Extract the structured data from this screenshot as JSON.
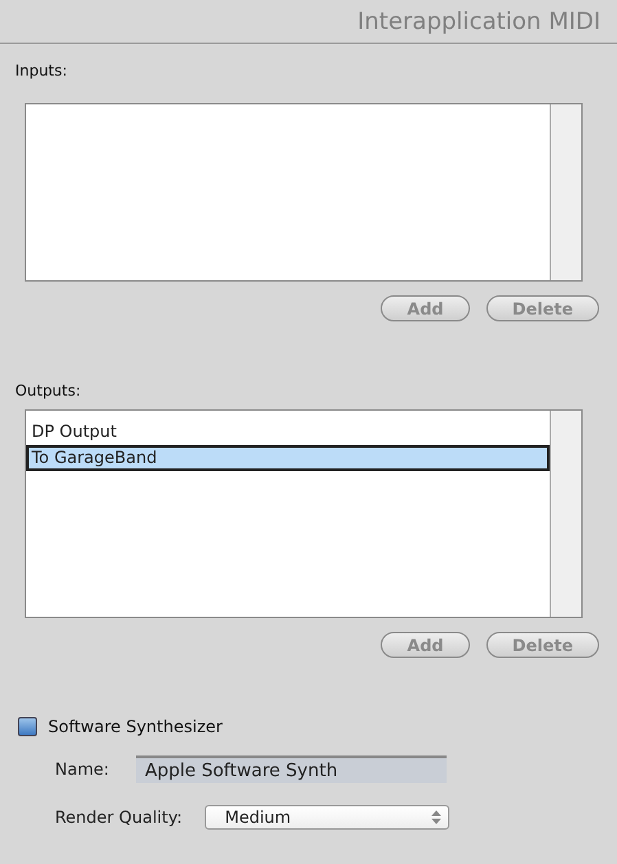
{
  "window": {
    "title": "Interapplication MIDI"
  },
  "inputs": {
    "label": "Inputs:",
    "buttons": [
      {
        "label": "Add",
        "disabled": true
      },
      {
        "label": "Delete",
        "disabled": true
      }
    ]
  },
  "outputs": {
    "label": "Outputs:",
    "items": [
      {
        "label": "DP Output",
        "selected": false
      },
      {
        "label": "To GarageBand",
        "selected": true
      }
    ],
    "buttons": [
      {
        "label": "Add",
        "disabled": true
      },
      {
        "label": "Delete",
        "disabled": true
      }
    ]
  },
  "synth": {
    "label": "Software Synthesizer",
    "checked": false,
    "name_label": "Name:",
    "name_value": "Apple Software Synth",
    "name_disabled": true,
    "quality_label": "Render Quality:",
    "quality_value": "Medium"
  }
}
